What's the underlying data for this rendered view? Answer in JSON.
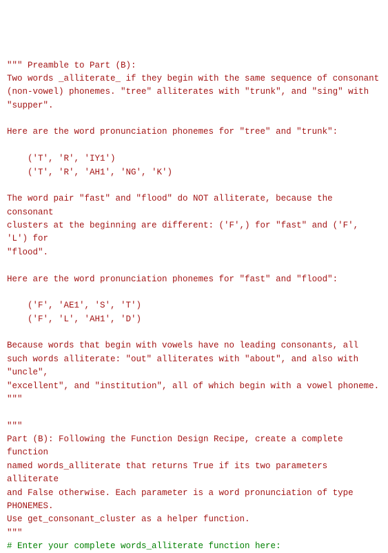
{
  "colors": {
    "string": "#a31515",
    "comment": "#008000"
  },
  "doc": {
    "d1_l1": "\"\"\" Preamble to Part (B):",
    "d1_l2": "Two words _alliterate_ if they begin with the same sequence of consonant",
    "d1_l3": "(non-vowel) phonemes. \"tree\" alliterates with \"trunk\", and \"sing\" with",
    "d1_l4": "\"supper\".",
    "d1_l5": "",
    "d1_l6": "Here are the word pronunciation phonemes for \"tree\" and \"trunk\":",
    "d1_l7": "",
    "d1_l8": "    ('T', 'R', 'IY1')",
    "d1_l9": "    ('T', 'R', 'AH1', 'NG', 'K')",
    "d1_l10": "",
    "d1_l11": "The word pair \"fast\" and \"flood\" do NOT alliterate, because the consonant",
    "d1_l12": "clusters at the beginning are different: ('F',) for \"fast\" and ('F', 'L') for",
    "d1_l13": "\"flood\".",
    "d1_l14": "",
    "d1_l15": "Here are the word pronunciation phonemes for \"fast\" and \"flood\":",
    "d1_l16": "",
    "d1_l17": "    ('F', 'AE1', 'S', 'T')",
    "d1_l18": "    ('F', 'L', 'AH1', 'D')",
    "d1_l19": "",
    "d1_l20": "Because words that begin with vowels have no leading consonants, all",
    "d1_l21": "such words alliterate: \"out\" alliterates with \"about\", and also with \"uncle\",",
    "d1_l22": "\"excellent\", and \"institution\", all of which begin with a vowel phoneme.",
    "d1_l23": "\"\"\"",
    "blank1": "",
    "d2_l1": "\"\"\"",
    "d2_l2": "Part (B): Following the Function Design Recipe, create a complete function",
    "d2_l3": "named words_alliterate that returns True if its two parameters alliterate",
    "d2_l4": "and False otherwise. Each parameter is a word pronunciation of type PHONEMES.",
    "d2_l5": "Use get_consonant_cluster as a helper function.",
    "d2_l6": "\"\"\"",
    "comment": "# Enter your complete words_alliterate function here:"
  }
}
